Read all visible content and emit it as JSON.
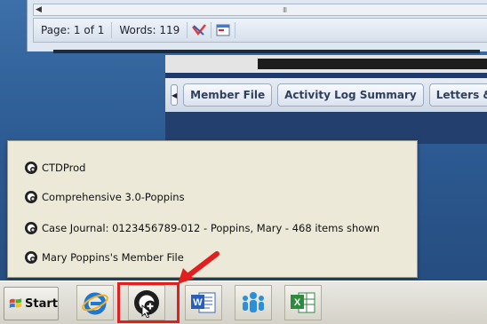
{
  "word": {
    "status_page": "Page: 1 of 1",
    "status_words": "Words: 119",
    "scroll_thumb": "III"
  },
  "app": {
    "tabs": [
      {
        "label": "Member File"
      },
      {
        "label": "Activity Log Summary"
      },
      {
        "label": "Letters &"
      }
    ]
  },
  "popup": {
    "items": [
      {
        "label": "CTDProd"
      },
      {
        "label": "Comprehensive 3.0-Poppins"
      },
      {
        "label": "Case Journal: 0123456789-012 - Poppins, Mary - 468 items shown"
      },
      {
        "label": "Mary Poppins's Member File"
      }
    ]
  },
  "taskbar": {
    "start_label": "Start",
    "buttons": [
      {
        "icon": "internet-explorer-icon"
      },
      {
        "icon": "app-launcher-icon"
      },
      {
        "icon": "word-icon"
      },
      {
        "icon": "people-icon"
      },
      {
        "icon": "excel-icon"
      }
    ]
  },
  "colors": {
    "highlight": "#e01f1f",
    "desktop": "#2f5a8f"
  }
}
